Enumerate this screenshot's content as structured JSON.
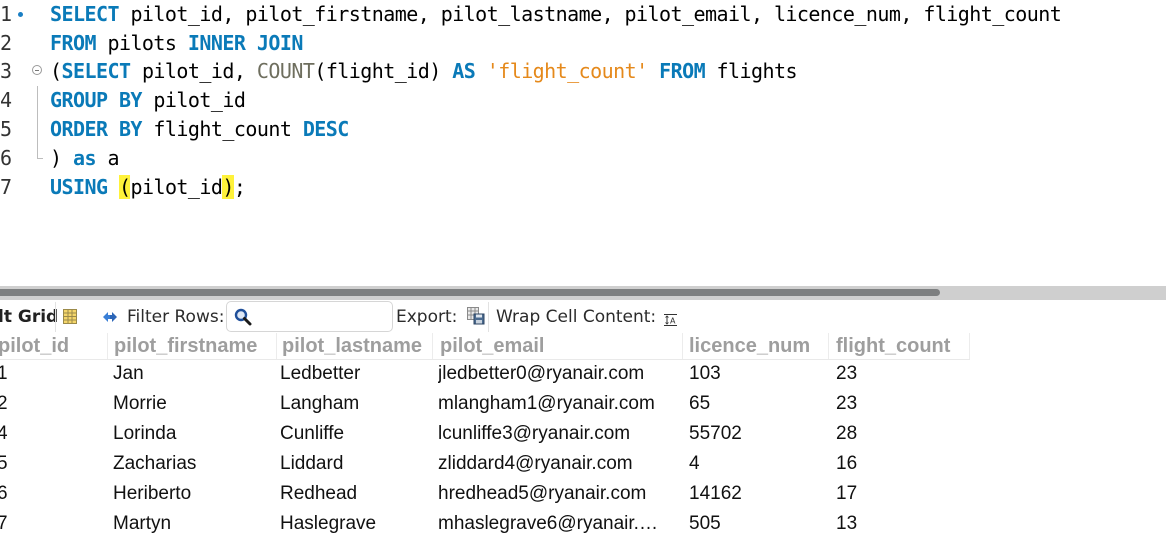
{
  "editor": {
    "lines": [
      {
        "num": "1",
        "tokens": [
          {
            "t": "SELECT",
            "c": "kw"
          },
          {
            "t": " pilot_id, pilot_firstname, pilot_lastname, pilot_email, licence_num, flight_count",
            "c": ""
          }
        ]
      },
      {
        "num": "2",
        "tokens": [
          {
            "t": "FROM",
            "c": "kw"
          },
          {
            "t": " pilots ",
            "c": ""
          },
          {
            "t": "INNER JOIN",
            "c": "kw"
          }
        ]
      },
      {
        "num": "3",
        "tokens": [
          {
            "t": "(",
            "c": ""
          },
          {
            "t": "SELECT",
            "c": "kw"
          },
          {
            "t": " pilot_id, ",
            "c": ""
          },
          {
            "t": "COUNT",
            "c": "fn"
          },
          {
            "t": "(flight_id) ",
            "c": ""
          },
          {
            "t": "AS",
            "c": "kw"
          },
          {
            "t": " ",
            "c": ""
          },
          {
            "t": "'flight_count'",
            "c": "str"
          },
          {
            "t": " ",
            "c": ""
          },
          {
            "t": "FROM",
            "c": "kw"
          },
          {
            "t": " flights",
            "c": ""
          }
        ]
      },
      {
        "num": "4",
        "tokens": [
          {
            "t": "GROUP BY",
            "c": "kw"
          },
          {
            "t": " pilot_id",
            "c": ""
          }
        ]
      },
      {
        "num": "5",
        "tokens": [
          {
            "t": "ORDER BY",
            "c": "kw"
          },
          {
            "t": " flight_count ",
            "c": ""
          },
          {
            "t": "DESC",
            "c": "kw"
          }
        ]
      },
      {
        "num": "6",
        "tokens": [
          {
            "t": ") ",
            "c": ""
          },
          {
            "t": "as",
            "c": "kw"
          },
          {
            "t": " a",
            "c": ""
          }
        ]
      },
      {
        "num": "7",
        "tokens": [
          {
            "t": "USING",
            "c": "kw"
          },
          {
            "t": " ",
            "c": ""
          },
          {
            "t": "(",
            "c": "bracket-hl"
          },
          {
            "t": "pilot_id",
            "c": ""
          },
          {
            "t": ")",
            "c": "bracket-hl"
          },
          {
            "t": ";",
            "c": ""
          }
        ]
      }
    ]
  },
  "toolbar": {
    "result_grid_label": "lt Grid",
    "filter_rows_label": "Filter Rows:",
    "filter_rows_value": "",
    "export_label": "Export:",
    "wrap_cell_label": "Wrap Cell Content:"
  },
  "grid": {
    "columns": [
      "pilot_id",
      "pilot_firstname",
      "pilot_lastname",
      "pilot_email",
      "licence_num",
      "flight_count"
    ],
    "rows": [
      [
        "1",
        "Jan",
        "Ledbetter",
        "jledbetter0@ryanair.com",
        "103",
        "23"
      ],
      [
        "2",
        "Morrie",
        "Langham",
        "mlangham1@ryanair.com",
        "65",
        "23"
      ],
      [
        "4",
        "Lorinda",
        "Cunliffe",
        "lcunliffe3@ryanair.com",
        "55702",
        "28"
      ],
      [
        "5",
        "Zacharias",
        "Liddard",
        "zliddard4@ryanair.com",
        "4",
        "16"
      ],
      [
        "6",
        "Heriberto",
        "Redhead",
        "hredhead5@ryanair.com",
        "14162",
        "17"
      ],
      [
        "7",
        "Martyn",
        "Haslegrave",
        "mhaslegrave6@ryanair.…",
        "505",
        "13"
      ]
    ]
  }
}
